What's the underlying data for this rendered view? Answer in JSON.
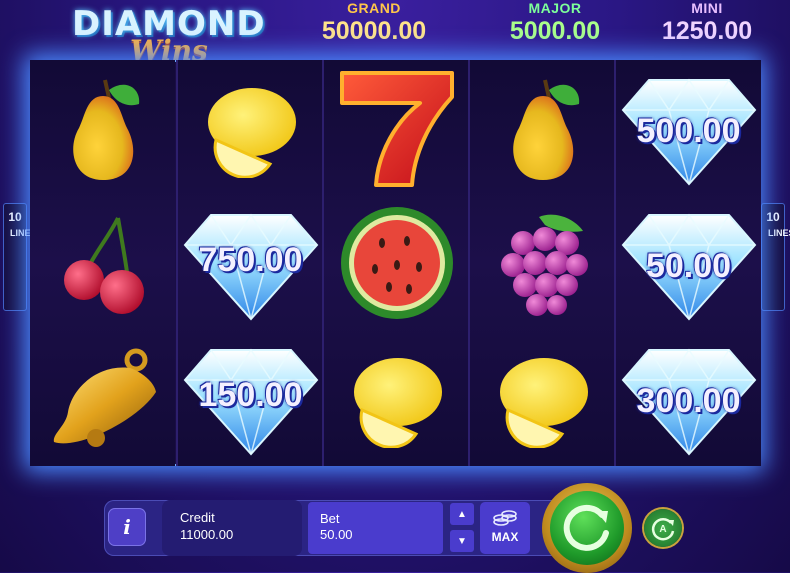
{
  "logo": {
    "line1": "DIAMOND",
    "line2": "Wins"
  },
  "jackpots": {
    "grand": {
      "label": "GRAND",
      "value": "50000.00"
    },
    "major": {
      "label": "MAJOR",
      "value": "5000.00"
    },
    "mini": {
      "label": "MINI",
      "value": "1250.00"
    }
  },
  "lines_indicator": {
    "count": "10",
    "word": "LINES"
  },
  "reels": [
    [
      "pear-icon",
      "cherries-icon",
      "bell-icon"
    ],
    [
      "lemon-icon",
      "diamond-icon",
      "diamond-icon"
    ],
    [
      "seven-icon",
      "watermelon-icon",
      "lemon-icon"
    ],
    [
      "pear-icon",
      "grapes-icon",
      "lemon-icon"
    ],
    [
      "diamond-icon",
      "diamond-icon",
      "diamond-icon"
    ]
  ],
  "diamond_values": {
    "r2_row2": "750.00",
    "r2_row3": "150.00",
    "r5_row1": "500.00",
    "r5_row2": "50.00",
    "r5_row3": "300.00"
  },
  "controls": {
    "info_label": "i",
    "credit_label": "Credit",
    "credit_value": "11000.00",
    "bet_label": "Bet",
    "bet_value": "50.00",
    "max_label": "MAX"
  },
  "colors": {
    "background": "#2a1784",
    "grand": "#ffc64a",
    "major": "#7dff9a",
    "mini": "#e8bfff",
    "spin": "#1f9a2a"
  }
}
